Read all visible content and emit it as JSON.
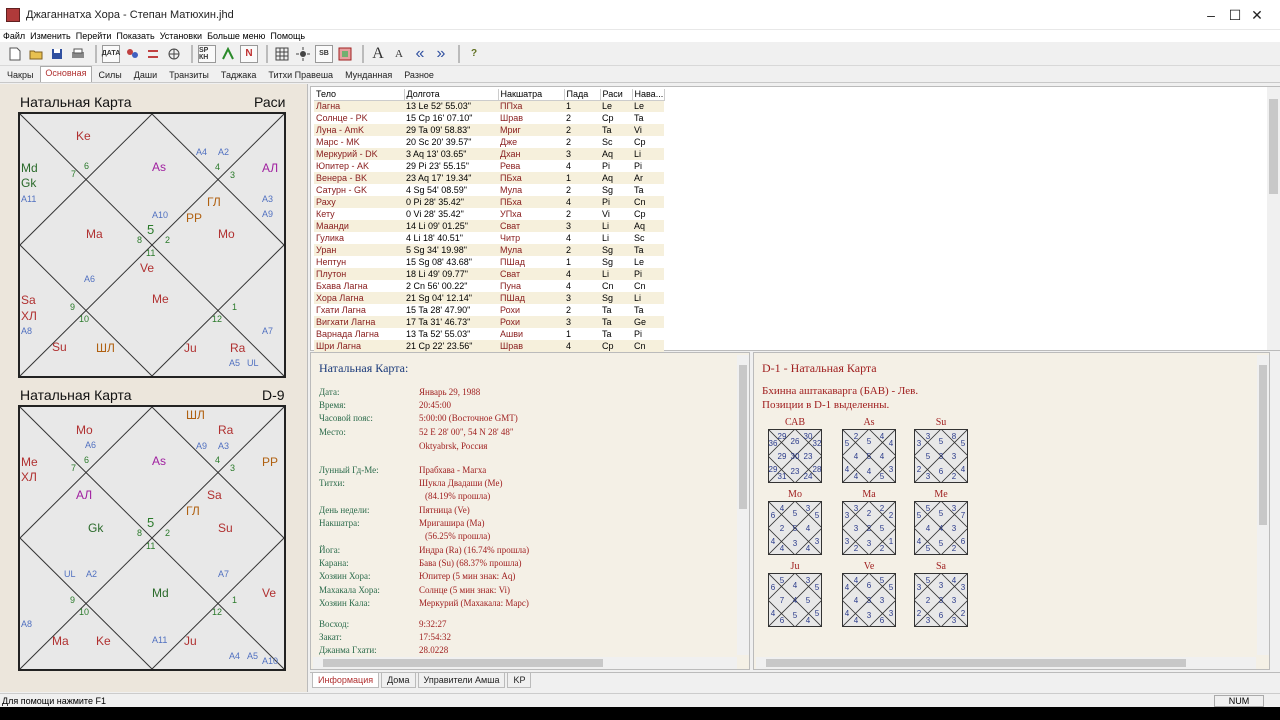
{
  "window": {
    "title": "Джаганнатха Хора - Степан Матюхин.jhd",
    "minimize": "–",
    "maximize": "☐",
    "close": "✕"
  },
  "menu": [
    "Файл",
    "Изменить",
    "Перейти",
    "Показать",
    "Установки",
    "Больше меню",
    "Помощь"
  ],
  "toolbar": {
    "data_btn": "ДАТА",
    "dk_btn": "SP КН",
    "n_btn": "N",
    "sb_btn": "SB",
    "font_big": "A",
    "font_small": "A",
    "prev": "«",
    "next": "»",
    "help": "?"
  },
  "tabs": [
    "Чакры",
    "Основная",
    "Силы",
    "Даши",
    "Транзиты",
    "Таджака",
    "Титхи Правеша",
    "Мунданная",
    "Разное"
  ],
  "active_tab": "Основная",
  "chart1": {
    "title": "Натальная Карта",
    "right": "Раси",
    "labels": [
      {
        "t": "Ke",
        "c": "#b03030"
      },
      {
        "t": "6",
        "c": "#2a7a2a"
      },
      {
        "t": "7",
        "c": "#2a7a2a"
      },
      {
        "t": "As",
        "c": "#a020a0"
      },
      {
        "t": "A4",
        "c": "#5070c0"
      },
      {
        "t": "A2",
        "c": "#5070c0"
      },
      {
        "t": "4",
        "c": "#2a7a2a"
      },
      {
        "t": "3",
        "c": "#2a7a2a"
      },
      {
        "t": "АЛ",
        "c": "#a020a0"
      },
      {
        "t": "Md",
        "c": "#2a6a2a"
      },
      {
        "t": "Gk",
        "c": "#2a6a2a"
      },
      {
        "t": "A11",
        "c": "#5070c0"
      },
      {
        "t": "A10",
        "c": "#5070c0"
      },
      {
        "t": "ГЛ",
        "c": "#b06010"
      },
      {
        "t": "PP",
        "c": "#b06010"
      },
      {
        "t": "A3",
        "c": "#5070c0"
      },
      {
        "t": "A9",
        "c": "#5070c0"
      },
      {
        "t": "Ma",
        "c": "#b03030"
      },
      {
        "t": "5",
        "c": "#2a7a2a"
      },
      {
        "t": "8",
        "c": "#2a7a2a"
      },
      {
        "t": "2",
        "c": "#2a7a2a"
      },
      {
        "t": "Mo",
        "c": "#b03030"
      },
      {
        "t": "11",
        "c": "#2a7a2a"
      },
      {
        "t": "Ve",
        "c": "#b03030"
      },
      {
        "t": "A6",
        "c": "#5070c0"
      },
      {
        "t": "Me",
        "c": "#b03030"
      },
      {
        "t": "Sa",
        "c": "#b03030"
      },
      {
        "t": "ХЛ",
        "c": "#b03030"
      },
      {
        "t": "A8",
        "c": "#5070c0"
      },
      {
        "t": "9",
        "c": "#2a7a2a"
      },
      {
        "t": "10",
        "c": "#2a7a2a"
      },
      {
        "t": "12",
        "c": "#2a7a2a"
      },
      {
        "t": "1",
        "c": "#2a7a2a"
      },
      {
        "t": "A7",
        "c": "#5070c0"
      },
      {
        "t": "Su",
        "c": "#b03030"
      },
      {
        "t": "ШЛ",
        "c": "#b06010"
      },
      {
        "t": "Ju",
        "c": "#b03030"
      },
      {
        "t": "Ra",
        "c": "#b03030"
      },
      {
        "t": "A5",
        "c": "#5070c0"
      },
      {
        "t": "UL",
        "c": "#5070c0"
      }
    ]
  },
  "chart2": {
    "title": "Натальная Карта",
    "right": "D-9",
    "labels": [
      {
        "t": "ШЛ",
        "c": "#b06010"
      },
      {
        "t": "Mo",
        "c": "#b03030"
      },
      {
        "t": "A6",
        "c": "#5070c0"
      },
      {
        "t": "Ra",
        "c": "#b03030"
      },
      {
        "t": "A9",
        "c": "#5070c0"
      },
      {
        "t": "A3",
        "c": "#5070c0"
      },
      {
        "t": "Me",
        "c": "#b03030"
      },
      {
        "t": "ХЛ",
        "c": "#b03030"
      },
      {
        "t": "6",
        "c": "#2a7a2a"
      },
      {
        "t": "7",
        "c": "#2a7a2a"
      },
      {
        "t": "As",
        "c": "#a020a0"
      },
      {
        "t": "4",
        "c": "#2a7a2a"
      },
      {
        "t": "3",
        "c": "#2a7a2a"
      },
      {
        "t": "PP",
        "c": "#b06010"
      },
      {
        "t": "АЛ",
        "c": "#a020a0"
      },
      {
        "t": "Sa",
        "c": "#b03030"
      },
      {
        "t": "Gk",
        "c": "#2a6a2a"
      },
      {
        "t": "5",
        "c": "#2a7a2a"
      },
      {
        "t": "8",
        "c": "#2a7a2a"
      },
      {
        "t": "2",
        "c": "#2a7a2a"
      },
      {
        "t": "ГЛ",
        "c": "#b06010"
      },
      {
        "t": "Su",
        "c": "#b03030"
      },
      {
        "t": "11",
        "c": "#2a7a2a"
      },
      {
        "t": "UL",
        "c": "#5070c0"
      },
      {
        "t": "A2",
        "c": "#5070c0"
      },
      {
        "t": "A7",
        "c": "#5070c0"
      },
      {
        "t": "Md",
        "c": "#2a6a2a"
      },
      {
        "t": "9",
        "c": "#2a7a2a"
      },
      {
        "t": "10",
        "c": "#2a7a2a"
      },
      {
        "t": "12",
        "c": "#2a7a2a"
      },
      {
        "t": "1",
        "c": "#2a7a2a"
      },
      {
        "t": "Ve",
        "c": "#b03030"
      },
      {
        "t": "A8",
        "c": "#5070c0"
      },
      {
        "t": "Ma",
        "c": "#b03030"
      },
      {
        "t": "Ke",
        "c": "#b03030"
      },
      {
        "t": "Ju",
        "c": "#b03030"
      },
      {
        "t": "A11",
        "c": "#5070c0"
      },
      {
        "t": "A4",
        "c": "#5070c0"
      },
      {
        "t": "A5",
        "c": "#5070c0"
      },
      {
        "t": "A10",
        "c": "#5070c0"
      }
    ]
  },
  "planet_table": {
    "headers": [
      "Тело",
      "Долгота",
      "Накшатра",
      "Пада",
      "Раси",
      "Нава..."
    ],
    "rows": [
      [
        "Лагна",
        "13 Le 52' 55.03\"",
        "ППха",
        "1",
        "Le",
        "Le"
      ],
      [
        "Солнце - PK",
        "15 Cp 16' 07.10\"",
        "Шрав",
        "2",
        "Cp",
        "Ta"
      ],
      [
        "Луна - AmK",
        "29 Ta 09' 58.83\"",
        "Мриг",
        "2",
        "Ta",
        "Vi"
      ],
      [
        "Марс - MK",
        "20 Sc 20' 39.57\"",
        "Дже",
        "2",
        "Sc",
        "Cp"
      ],
      [
        "Меркурий - DK",
        "3 Aq 13' 03.65\"",
        "Дхан",
        "3",
        "Aq",
        "Li"
      ],
      [
        "Юпитер - AK",
        "29 Pi 23' 55.15\"",
        "Рева",
        "4",
        "Pi",
        "Pi"
      ],
      [
        "Венера - BK",
        "23 Aq 17' 19.34\"",
        "ПБха",
        "1",
        "Aq",
        "Ar"
      ],
      [
        "Сатурн - GK",
        "4 Sg 54' 08.59\"",
        "Мула",
        "2",
        "Sg",
        "Ta"
      ],
      [
        "Раху",
        "0 Pi 28' 35.42\"",
        "ПБха",
        "4",
        "Pi",
        "Cn"
      ],
      [
        "Кету",
        "0 Vi 28' 35.42\"",
        "УПха",
        "2",
        "Vi",
        "Cp"
      ],
      [
        "Маанди",
        "14 Li 09' 01.25\"",
        "Сват",
        "3",
        "Li",
        "Aq"
      ],
      [
        "Гулика",
        "4 Li 18' 40.51\"",
        "Читр",
        "4",
        "Li",
        "Sc"
      ],
      [
        "Уран",
        "5 Sg 34' 19.98\"",
        "Мула",
        "2",
        "Sg",
        "Ta"
      ],
      [
        "Нептун",
        "15 Sg 08' 43.68\"",
        "ПШад",
        "1",
        "Sg",
        "Le"
      ],
      [
        "Плутон",
        "18 Li 49' 09.77\"",
        "Сват",
        "4",
        "Li",
        "Pi"
      ],
      [
        "Бхава Лагна",
        "2 Cn 56' 00.22\"",
        "Пуна",
        "4",
        "Cn",
        "Cn"
      ],
      [
        "Хора Лагна",
        "21 Sg 04' 12.14\"",
        "ПШад",
        "3",
        "Sg",
        "Li"
      ],
      [
        "Гхати Лагна",
        "15 Ta 28' 47.90\"",
        "Рохи",
        "2",
        "Ta",
        "Ta"
      ],
      [
        "Вигхати Лагна",
        "17 Ta 31' 46.73\"",
        "Рохи",
        "3",
        "Ta",
        "Ge"
      ],
      [
        "Варнада Лагна",
        "13 Ta 52' 55.03\"",
        "Ашви",
        "1",
        "Ta",
        "Pi"
      ],
      [
        "Шри Лагна",
        "21 Cp 22' 23.56\"",
        "Шрав",
        "4",
        "Cp",
        "Cn"
      ]
    ]
  },
  "info": {
    "heading": "Натальная Карта:",
    "rows": [
      {
        "k": "Дата:",
        "v": "Январь 29, 1988"
      },
      {
        "k": "Время:",
        "v": "20:45:00"
      },
      {
        "k": "Часовой пояс:",
        "v": "5:00:00 (Восточное GMT)"
      },
      {
        "k": "Место:",
        "v": "52 E 28' 00\", 54 N 28' 48\""
      },
      {
        "k": "",
        "v": "Oktyabrsk, Россия"
      },
      {
        "k": "Лунный Гд-Ме:",
        "v": "Прабхава - Магха"
      },
      {
        "k": "Титхи:",
        "v": "Шукла Двадаши (Me)"
      },
      {
        "k": "",
        "v": "(84.19% прошла)"
      },
      {
        "k": "День недели:",
        "v": "Пятница (Ve)"
      },
      {
        "k": "Накшатра:",
        "v": "Мригашира (Ma)"
      },
      {
        "k": "",
        "v": "(56.25% прошла)"
      },
      {
        "k": "Йога:",
        "v": "Индра (Ra) (16.74% прошла)"
      },
      {
        "k": "Карана:",
        "v": "Бава (Su) (68.37% прошла)"
      },
      {
        "k": "Хозяин Хора:",
        "v": "Юпитер (5 мин знак: Aq)"
      },
      {
        "k": "Махакала Хора:",
        "v": "Солнце (5 мин знак: Vi)"
      },
      {
        "k": "Хозяин Кала:",
        "v": "Меркурий (Махакала: Марс)"
      },
      {
        "k": "Восход:",
        "v": "9:32:27"
      },
      {
        "k": "Закат:",
        "v": "17:54:32"
      },
      {
        "k": "Джанма Гхати:",
        "v": "28.0228"
      }
    ]
  },
  "bav": {
    "heading": "D-1 - Натальная Карта",
    "line1": "Бхинна аштакаварга (БАВ) - Лев.",
    "line2": "Позиции в D-1 выделенны.",
    "charts": [
      {
        "name": "САВ",
        "n": [
          "26",
          "29",
          "30",
          "36",
          "32",
          "29",
          "23",
          "29",
          "28",
          "31",
          "24",
          "23",
          "30"
        ]
      },
      {
        "name": "As",
        "n": [
          "5",
          "2",
          "4",
          "5",
          "4",
          "4",
          "4",
          "4",
          "3",
          "4",
          "5",
          "4",
          "5"
        ]
      },
      {
        "name": "Su",
        "n": [
          "5",
          "3",
          "8",
          "3",
          "5",
          "5",
          "3",
          "2",
          "4",
          "3",
          "2",
          "6",
          "3"
        ]
      },
      {
        "name": "Mo",
        "n": [
          "5",
          "4",
          "3",
          "6",
          "5",
          "2",
          "4",
          "4",
          "3",
          "4",
          "4",
          "3",
          "5"
        ]
      },
      {
        "name": "Ma",
        "n": [
          "2",
          "3",
          "2",
          "3",
          "2",
          "3",
          "5",
          "3",
          "1",
          "2",
          "2",
          "3",
          "2"
        ]
      },
      {
        "name": "Me",
        "n": [
          "5",
          "5",
          "3",
          "5",
          "7",
          "4",
          "3",
          "4",
          "6",
          "5",
          "2",
          "5",
          "4"
        ]
      },
      {
        "name": "Ju",
        "n": [
          "4",
          "5",
          "3",
          "6",
          "5",
          "7",
          "5",
          "4",
          "5",
          "6",
          "4",
          "5",
          "4"
        ]
      },
      {
        "name": "Ve",
        "n": [
          "6",
          "4",
          "5",
          "4",
          "5",
          "4",
          "3",
          "4",
          "3",
          "4",
          "6",
          "3",
          "3"
        ]
      },
      {
        "name": "Sa",
        "n": [
          "3",
          "5",
          "4",
          "3",
          "3",
          "2",
          "3",
          "2",
          "2",
          "3",
          "3",
          "6",
          "3"
        ]
      }
    ]
  },
  "bottom_tabs": [
    "Информация",
    "Дома",
    "Управители Амша",
    "KP"
  ],
  "status": {
    "message": "Для помощи нажмите F1",
    "num": "NUM"
  }
}
